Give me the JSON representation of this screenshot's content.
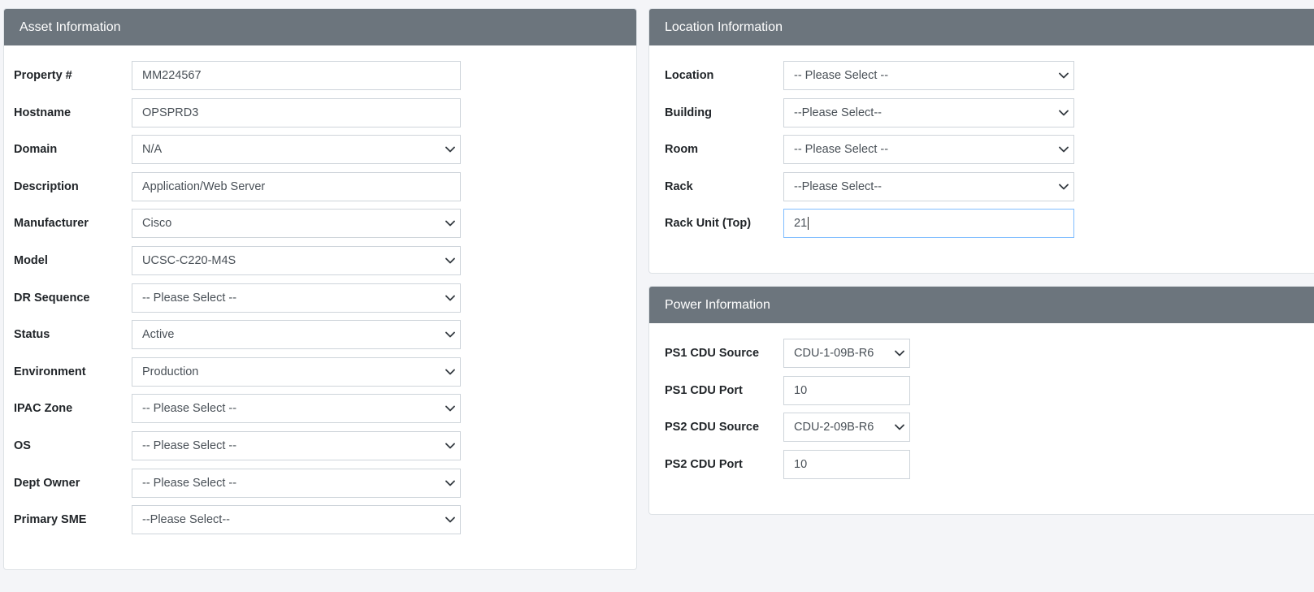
{
  "asset": {
    "title": "Asset Information",
    "fields": [
      {
        "label": "Property #",
        "value": "MM224567",
        "type": "text"
      },
      {
        "label": "Hostname",
        "value": "OPSPRD3",
        "type": "text"
      },
      {
        "label": "Domain",
        "value": "N/A",
        "type": "select"
      },
      {
        "label": "Description",
        "value": "Application/Web Server",
        "type": "text"
      },
      {
        "label": "Manufacturer",
        "value": "Cisco",
        "type": "select"
      },
      {
        "label": "Model",
        "value": "UCSC-C220-M4S",
        "type": "select"
      },
      {
        "label": "DR Sequence",
        "value": "-- Please Select --",
        "type": "select"
      },
      {
        "label": "Status",
        "value": "Active",
        "type": "select"
      },
      {
        "label": "Environment",
        "value": "Production",
        "type": "select"
      },
      {
        "label": "IPAC Zone",
        "value": "-- Please Select --",
        "type": "select"
      },
      {
        "label": "OS",
        "value": "-- Please Select --",
        "type": "select"
      },
      {
        "label": "Dept Owner",
        "value": "-- Please Select --",
        "type": "select"
      },
      {
        "label": "Primary SME",
        "value": "--Please Select--",
        "type": "select"
      }
    ]
  },
  "location": {
    "title": "Location Information",
    "fields": [
      {
        "label": "Location",
        "value": "-- Please Select --",
        "type": "select"
      },
      {
        "label": "Building",
        "value": "--Please Select--",
        "type": "select"
      },
      {
        "label": "Room",
        "value": "-- Please Select --",
        "type": "select"
      },
      {
        "label": "Rack",
        "value": "--Please Select--",
        "type": "select"
      },
      {
        "label": "Rack Unit (Top)",
        "value": "21",
        "type": "text"
      }
    ]
  },
  "power": {
    "title": "Power Information",
    "fields": [
      {
        "label": "PS1 CDU Source",
        "value": "CDU-1-09B-R6",
        "type": "select"
      },
      {
        "label": "PS1 CDU Port",
        "value": "10",
        "type": "text"
      },
      {
        "label": "PS2 CDU Source",
        "value": "CDU-2-09B-R6",
        "type": "select"
      },
      {
        "label": "PS2 CDU Port",
        "value": "10",
        "type": "text"
      }
    ]
  },
  "icons": {
    "select_arrow": "chevron-down-icon"
  },
  "colors": {
    "header_bg": "#6c757d",
    "focus_border": "#80bdff"
  }
}
